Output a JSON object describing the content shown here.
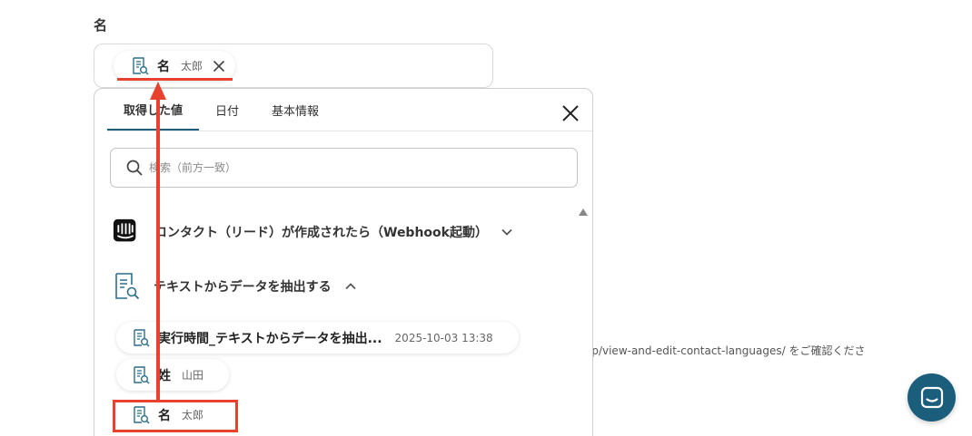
{
  "field": {
    "label": "名"
  },
  "selected_chip": {
    "label": "名",
    "value": "太郎"
  },
  "tabs": [
    {
      "label": "取得した値",
      "active": true
    },
    {
      "label": "日付",
      "active": false
    },
    {
      "label": "基本情報",
      "active": false
    }
  ],
  "search": {
    "placeholder": "検索（前方一致）"
  },
  "groups": [
    {
      "title": "コンタクト（リード）が作成されたら（Webhook起動）",
      "icon": "intercom-logo-icon",
      "expanded": false
    },
    {
      "title": "テキストからデータを抽出する",
      "icon": "document-search-icon",
      "expanded": true
    }
  ],
  "items": [
    {
      "label": "実行時間_テキストからデータを抽出...",
      "value": "2025-10-03 13:38"
    },
    {
      "label": "姓",
      "value": "山田"
    },
    {
      "label": "名",
      "value": "太郎"
    }
  ],
  "background": {
    "help_text": "lp/view-and-edit-contact-languages/ をご確認くださ"
  },
  "colors": {
    "accent": "#1e5f80",
    "highlight": "#e8412d",
    "chat_button": "#1b5e7c"
  }
}
